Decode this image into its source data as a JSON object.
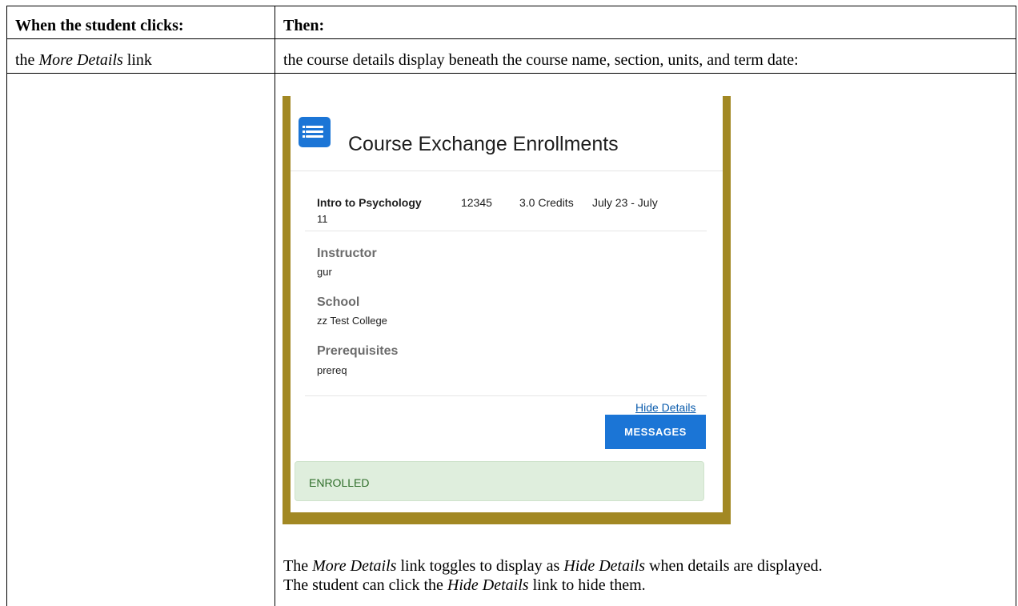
{
  "table": {
    "header_col1": "When the student clicks:",
    "header_col2": "Then:",
    "row1": {
      "click_prefix": "the ",
      "click_link": "More Details",
      "click_suffix": " link",
      "result_intro": "the course details display beneath the course name, section, units, and term date:",
      "toggle_p1_prefix": "The ",
      "toggle_p1_link": "More Details",
      "toggle_p1_mid": " link toggles to display as ",
      "toggle_p1_link2": "Hide Details",
      "toggle_p1_suffix": " when details are displayed.",
      "toggle_p2_prefix": "The student can click the ",
      "toggle_p2_link": "Hide Details",
      "toggle_p2_suffix": " link to hide them."
    }
  },
  "screenshot": {
    "title": "Course Exchange Enrollments",
    "icon": "list-icon",
    "course": {
      "name": "Intro to Psychology",
      "section": "12345",
      "units": "3.0 Credits",
      "term_line1": "July 23 - July",
      "term_line2": "11"
    },
    "fields": [
      {
        "label": "Instructor",
        "value": "gur"
      },
      {
        "label": "School",
        "value": "zz Test College"
      },
      {
        "label": "Prerequisites",
        "value": "prereq"
      }
    ],
    "hide_details_link": "Hide Details",
    "messages_button": "MESSAGES",
    "status": "ENROLLED",
    "colors": {
      "frame": "#a28823",
      "accent": "#1b75d6",
      "status_bg": "#dfeedd",
      "status_text": "#2f6e2a"
    }
  }
}
